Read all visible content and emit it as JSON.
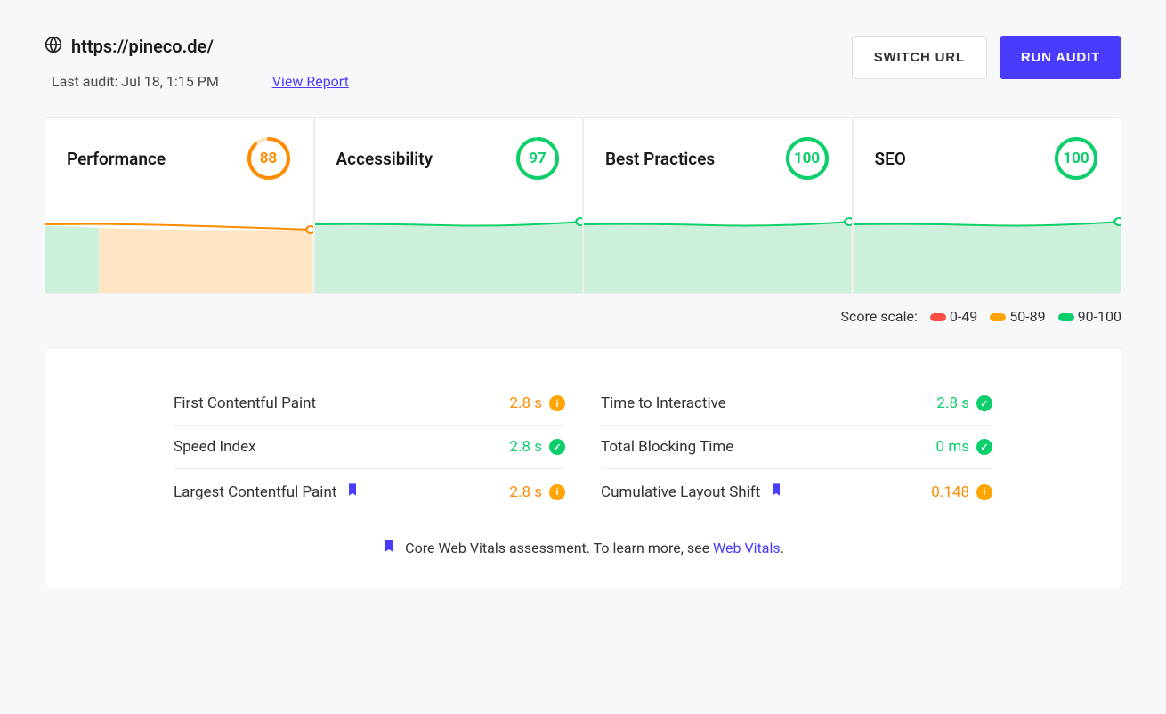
{
  "header": {
    "url": "https://pineco.de/",
    "last_audit_label": "Last audit: Jul 18, 1:15 PM",
    "view_report": "View Report",
    "switch_url": "SWITCH URL",
    "run_audit": "RUN AUDIT"
  },
  "cards": [
    {
      "title": "Performance",
      "score": 88,
      "rating": "orange"
    },
    {
      "title": "Accessibility",
      "score": 97,
      "rating": "green"
    },
    {
      "title": "Best Practices",
      "score": 100,
      "rating": "green"
    },
    {
      "title": "SEO",
      "score": 100,
      "rating": "green"
    }
  ],
  "legend": {
    "label": "Score scale:",
    "r0": "0-49",
    "r1": "50-89",
    "r2": "90-100"
  },
  "metrics_left": [
    {
      "label": "First Contentful Paint",
      "value": "2.8 s",
      "status": "info",
      "bookmark": false
    },
    {
      "label": "Speed Index",
      "value": "2.8 s",
      "status": "check",
      "bookmark": false
    },
    {
      "label": "Largest Contentful Paint",
      "value": "2.8 s",
      "status": "info",
      "bookmark": true
    }
  ],
  "metrics_right": [
    {
      "label": "Time to Interactive",
      "value": "2.8 s",
      "status": "check",
      "bookmark": false
    },
    {
      "label": "Total Blocking Time",
      "value": "0 ms",
      "status": "check",
      "bookmark": false
    },
    {
      "label": "Cumulative Layout Shift",
      "value": "0.148",
      "status": "info",
      "bookmark": true
    }
  ],
  "footer": {
    "text_a": "Core Web Vitals assessment. To learn more, see ",
    "link": "Web Vitals",
    "text_b": "."
  }
}
